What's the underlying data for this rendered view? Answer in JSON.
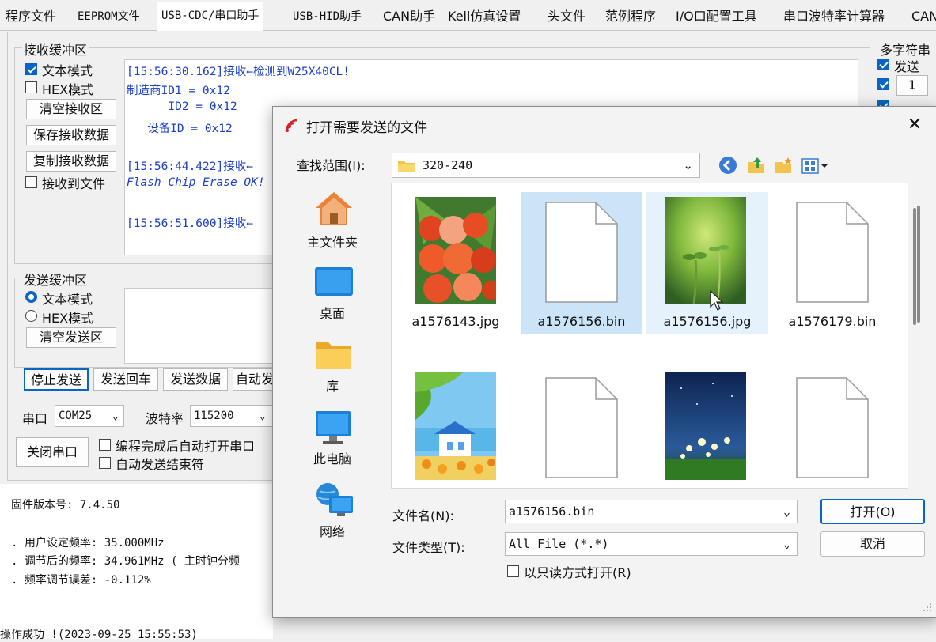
{
  "tabs": [
    "程序文件",
    "EEPROM文件",
    "USB-CDC/串口助手",
    "USB-HID助手",
    "CAN助手",
    "Keil仿真设置",
    "头文件",
    "范例程序",
    "I/O口配置工具",
    "串口波特率计算器",
    "CAN"
  ],
  "active_tab_index": 2,
  "receive": {
    "group_label": "接收缓冲区",
    "text_mode": "文本模式",
    "hex_mode": "HEX模式",
    "clear_btn": "清空接收区",
    "save_btn": "保存接收数据",
    "copy_btn": "复制接收数据",
    "to_file": "接收到文件",
    "lines": [
      "[15:56:30.162]接收←检测到W25X40CL!",
      "制造商ID1 = 0x12",
      "      ID2 = 0x12",
      "   设备ID = 0x12",
      "",
      "[15:56:44.422]接收←",
      "Flash Chip Erase OK!",
      "",
      "[15:56:51.600]接收←"
    ]
  },
  "send": {
    "group_label": "发送缓冲区",
    "text_mode": "文本模式",
    "hex_mode": "HEX模式",
    "clear_btn": "清空发送区",
    "stop_btn": "停止发送",
    "send_cr_btn": "发送回车",
    "send_data_btn": "发送数据",
    "auto_btn": "自动发"
  },
  "port": {
    "port_label": "串口",
    "port_value": "COM25",
    "baud_label": "波特率",
    "baud_value": "115200",
    "close_btn": "关闭串口",
    "auto_open": "编程完成后自动打开串口",
    "auto_end": "自动发送结束符"
  },
  "multi": {
    "title": "多字符串",
    "send_label": "发送",
    "num1": "1"
  },
  "log": {
    "lines": [
      "固件版本号: 7.4.50",
      ". 用户设定频率: 35.000MHz",
      ". 调节后的频率: 34.961MHz ( 主时钟分频",
      ". 频率调节误差: -0.112%",
      "操作成功 !(2023-09-25 15:55:53)"
    ]
  },
  "dialog": {
    "title": "打开需要发送的文件",
    "lookin_label": "查找范围(I):",
    "folder": "320-240",
    "sidebar": [
      "主文件夹",
      "桌面",
      "库",
      "此电脑",
      "网络"
    ],
    "files": [
      {
        "name": "a1576143.jpg",
        "kind": "peach"
      },
      {
        "name": "a1576156.bin",
        "kind": "doc"
      },
      {
        "name": "a1576156.jpg",
        "kind": "sprout"
      },
      {
        "name": "a1576179.bin",
        "kind": "doc"
      },
      {
        "name": "",
        "kind": "house"
      },
      {
        "name": "",
        "kind": "doc"
      },
      {
        "name": "",
        "kind": "night"
      },
      {
        "name": "",
        "kind": "doc"
      }
    ],
    "filename_label": "文件名(N):",
    "filename_value": "a1576156.bin",
    "filetype_label": "文件类型(T):",
    "filetype_value": "All File (*.*)",
    "readonly_label": "以只读方式打开(R)",
    "open_btn": "打开(O)",
    "cancel_btn": "取消"
  },
  "colors": {
    "accent": "#0a64c8",
    "recv_text": "#1a3fc8",
    "selection": "#cce4f7"
  }
}
